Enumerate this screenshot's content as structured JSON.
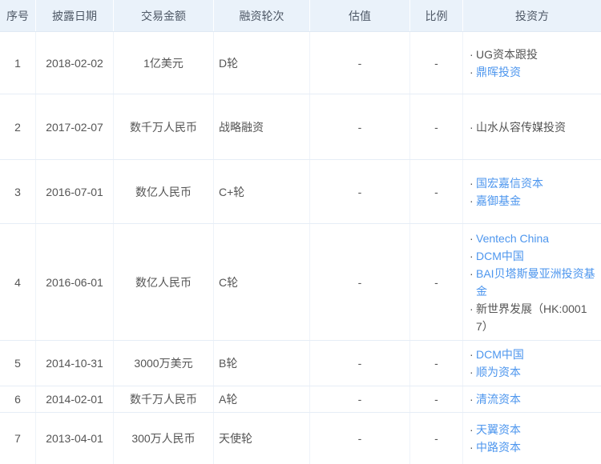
{
  "table": {
    "bullet": "·",
    "colors": {
      "link": "#4D96EE",
      "header_bg": "#EAF2FA",
      "text": "#555555",
      "border": "#E6EDF6"
    },
    "columns": [
      {
        "key": "index",
        "label": "序号"
      },
      {
        "key": "date",
        "label": "披露日期"
      },
      {
        "key": "amount",
        "label": "交易金额"
      },
      {
        "key": "round",
        "label": "融资轮次"
      },
      {
        "key": "valuation",
        "label": "估值"
      },
      {
        "key": "ratio",
        "label": "比例"
      },
      {
        "key": "investors",
        "label": "投资方"
      }
    ],
    "rows": [
      {
        "index": "1",
        "date": "2018-02-02",
        "amount": "1亿美元",
        "round": "D轮",
        "valuation": "-",
        "ratio": "-",
        "investors": [
          {
            "name": "UG资本跟投",
            "link": false
          },
          {
            "name": "鼎晖投资",
            "link": true
          }
        ]
      },
      {
        "index": "2",
        "date": "2017-02-07",
        "amount": "数千万人民币",
        "round": "战略融资",
        "valuation": "-",
        "ratio": "-",
        "investors": [
          {
            "name": "山水从容传媒投资",
            "link": false
          }
        ]
      },
      {
        "index": "3",
        "date": "2016-07-01",
        "amount": "数亿人民币",
        "round": "C+轮",
        "valuation": "-",
        "ratio": "-",
        "investors": [
          {
            "name": "国宏嘉信资本",
            "link": true
          },
          {
            "name": "嘉御基金",
            "link": true
          }
        ]
      },
      {
        "index": "4",
        "date": "2016-06-01",
        "amount": "数亿人民币",
        "round": "C轮",
        "valuation": "-",
        "ratio": "-",
        "investors": [
          {
            "name": "Ventech China",
            "link": true
          },
          {
            "name": "DCM中国",
            "link": true
          },
          {
            "name": "BAI贝塔斯曼亚洲投资基金",
            "link": true
          },
          {
            "name": "新世界发展（HK:00017）",
            "link": false
          }
        ]
      },
      {
        "index": "5",
        "date": "2014-10-31",
        "amount": "3000万美元",
        "round": "B轮",
        "valuation": "-",
        "ratio": "-",
        "investors": [
          {
            "name": "DCM中国",
            "link": true
          },
          {
            "name": "顺为资本",
            "link": true
          }
        ]
      },
      {
        "index": "6",
        "date": "2014-02-01",
        "amount": "数千万人民币",
        "round": "A轮",
        "valuation": "-",
        "ratio": "-",
        "investors": [
          {
            "name": "清流资本",
            "link": true
          }
        ]
      },
      {
        "index": "7",
        "date": "2013-04-01",
        "amount": "300万人民币",
        "round": "天使轮",
        "valuation": "-",
        "ratio": "-",
        "investors": [
          {
            "name": "天翼资本",
            "link": true
          },
          {
            "name": "中路资本",
            "link": true
          }
        ]
      }
    ]
  }
}
